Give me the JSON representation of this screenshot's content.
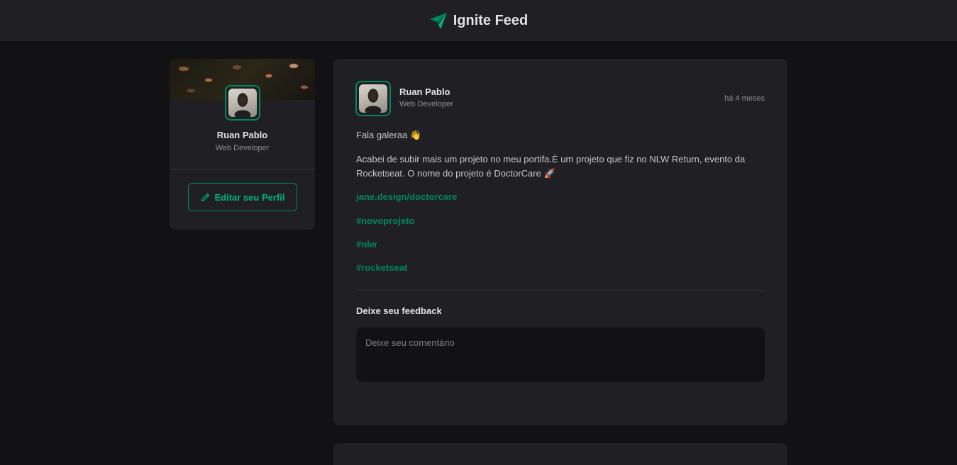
{
  "header": {
    "title": "Ignite Feed",
    "logo_icon": "paper-plane-icon"
  },
  "colors": {
    "accent": "#00875f",
    "accent_light": "#00b37e",
    "bg": "#121214",
    "surface": "#202024"
  },
  "sidebar": {
    "name": "Ruan Pablo",
    "role": "Web Developer",
    "edit_button": "Editar seu Perfil",
    "edit_icon": "pencil-icon"
  },
  "post": {
    "author": {
      "name": "Ruan Pablo",
      "role": "Web Developer"
    },
    "published": "há 4 meses",
    "content": {
      "greeting": "Fala galeraa 👋",
      "body": "Acabei de subir mais um projeto no meu portifa.É um projeto que fiz no NLW Return, evento da Rocketseat. O nome do projeto é DoctorCare 🚀",
      "link": "jane.design/doctorcare",
      "hashtags": [
        "#novoprojeto",
        "#nlw",
        "#rocketseat"
      ]
    },
    "feedback": {
      "title": "Deixe seu feedback",
      "placeholder": "Deixe seu comentário"
    }
  }
}
